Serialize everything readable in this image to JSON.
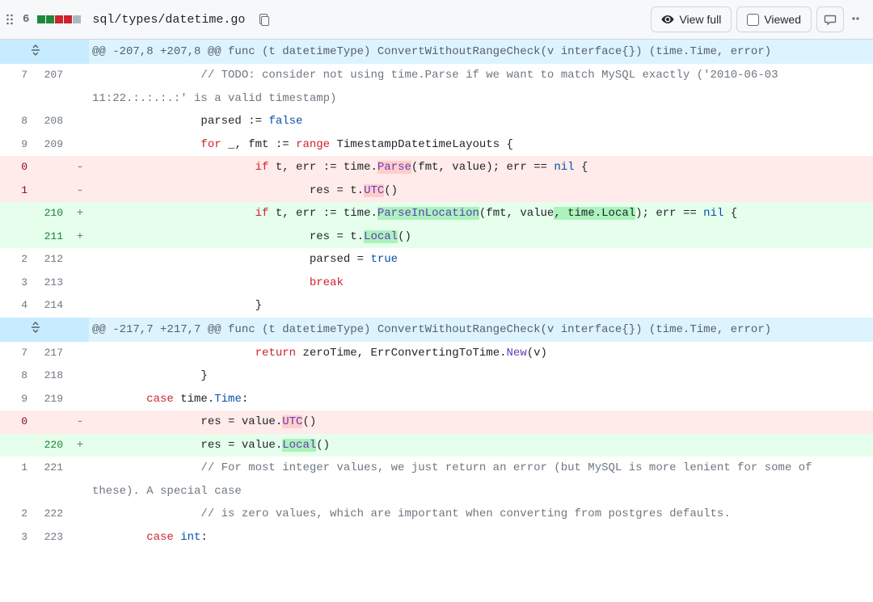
{
  "file": {
    "path": "sql/types/datetime.go",
    "changes_count": "6"
  },
  "buttons": {
    "view_full": "View full",
    "viewed": "Viewed"
  },
  "hunks": {
    "h1": "@@ -207,8 +207,8 @@ func (t datetimeType) ConvertWithoutRangeCheck(v interface{}) (time.Time, error)",
    "h2": "@@ -217,7 +217,7 @@ func (t datetimeType) ConvertWithoutRangeCheck(v interface{}) (time.Time, error)"
  },
  "lines": {
    "l207": {
      "old": "7",
      "new": "207",
      "comment": "// TODO: consider not using time.Parse if we want to match MySQL exactly ('2010-06-03 11:22.:.:.:.:' is a valid timestamp)"
    },
    "l208": {
      "old": "8",
      "new": "208",
      "t1": "parsed",
      "t2": " := ",
      "t3": "false"
    },
    "l209": {
      "old": "9",
      "new": "209",
      "t1": "for",
      "t2": " _, fmt := ",
      "t3": "range",
      "t4": " TimestampDatetimeLayouts {"
    },
    "d1": {
      "old": "0",
      "t1": "if",
      "t2": " t, err := time.",
      "fn": "Parse",
      "t3": "(fmt, value); err == ",
      "lit": "nil",
      "t4": " {"
    },
    "d2": {
      "old": "1",
      "t1": "res = t.",
      "fn": "UTC",
      "t2": "()"
    },
    "a1": {
      "new": "210",
      "t1": "if",
      "t2": " t, err := time.",
      "fn": "ParseInLocation",
      "t3": "(fmt, value",
      "arg": ", time.Local",
      "t4": "); err == ",
      "lit": "nil",
      "t5": " {"
    },
    "a2": {
      "new": "211",
      "t1": "res = t.",
      "fn": "Local",
      "t2": "()"
    },
    "l212": {
      "old": "2",
      "new": "212",
      "t1": "parsed = ",
      "lit": "true"
    },
    "l213": {
      "old": "3",
      "new": "213",
      "t1": "break"
    },
    "l214": {
      "old": "4",
      "new": "214",
      "t1": "}"
    },
    "l217": {
      "old": "7",
      "new": "217",
      "t1": "return",
      "t2": " zeroTime, ErrConvertingToTime.",
      "fn": "New",
      "t3": "(v)"
    },
    "l218": {
      "old": "8",
      "new": "218",
      "t1": "}"
    },
    "l219": {
      "old": "9",
      "new": "219",
      "t1": "case",
      "t2": " time.",
      "nb": "Time",
      "t3": ":"
    },
    "d3": {
      "old": "0",
      "t1": "res = value.",
      "fn": "UTC",
      "t2": "()"
    },
    "a3": {
      "new": "220",
      "t1": "res = value.",
      "fn": "Local",
      "t2": "()"
    },
    "l221": {
      "old": "1",
      "new": "221",
      "comment": "// For most integer values, we just return an error (but MySQL is more lenient for some of these). A special case"
    },
    "l222": {
      "old": "2",
      "new": "222",
      "comment": "// is zero values, which are important when converting from postgres defaults."
    },
    "l223": {
      "old": "3",
      "new": "223",
      "t1": "case",
      "t2": " ",
      "nb": "int",
      "t3": ":"
    }
  }
}
